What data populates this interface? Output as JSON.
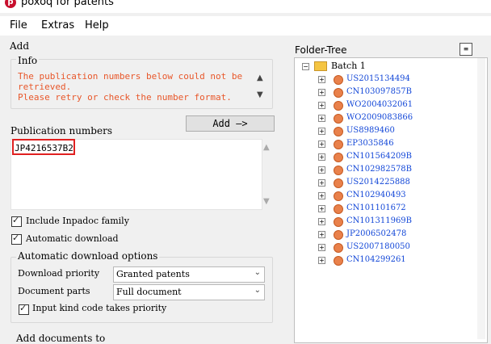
{
  "app": {
    "title": "poxoq for patents",
    "icon_glyph": "p"
  },
  "menu": [
    "File",
    "Extras",
    "Help"
  ],
  "add_section": {
    "label": "Add",
    "info_label": "Info",
    "info_text": "The publication numbers below could not be retrieved.\nPlease retry or check the number format.",
    "add_button": "Add —>",
    "pubnum_label": "Publication numbers",
    "pubnum_value": "JP4216537B2"
  },
  "options": {
    "include_inpadoc": "Include Inpadoc family",
    "automatic_download": "Automatic download",
    "auto_options_label": "Automatic download options",
    "download_priority_label": "Download priority",
    "download_priority_value": "Granted patents",
    "document_parts_label": "Document parts",
    "document_parts_value": "Full document",
    "input_kind_code": "Input kind code takes priority",
    "add_documents_to": "Add documents to"
  },
  "tree": {
    "label": "Folder-Tree",
    "batch_label": "Batch 1",
    "items": [
      "US2015134494",
      "CN103097857B",
      "WO2004032061",
      "WO2009083866",
      "US8989460",
      "EP3035846",
      "CN101564209B",
      "CN102982578B",
      "US2014225888",
      "CN102940493",
      "CN101101672",
      "CN101311969B",
      "JP2006502478",
      "US2007180050",
      "CN104299261"
    ]
  },
  "colors": {
    "info_text": "#e8572a",
    "link": "#1448d8",
    "highlight": "#e02020"
  }
}
